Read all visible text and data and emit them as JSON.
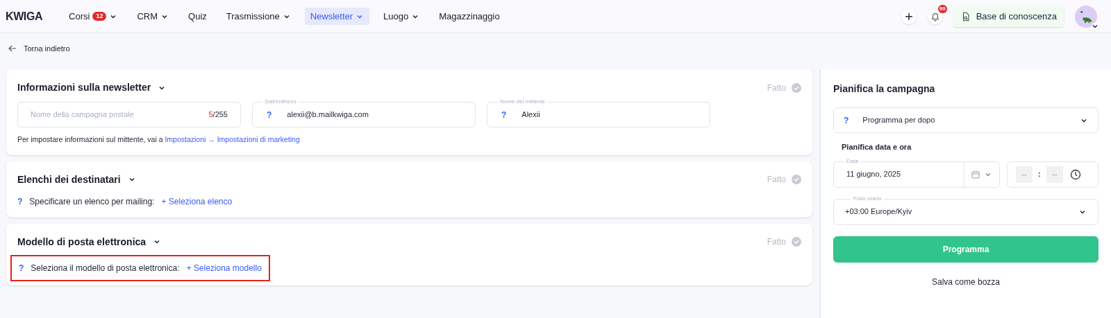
{
  "header": {
    "logo": "KWIGA",
    "nav": [
      {
        "label": "Corsi",
        "badge": "12",
        "dropdown": true,
        "selected": false
      },
      {
        "label": "CRM",
        "dropdown": true,
        "selected": false
      },
      {
        "label": "Quiz",
        "dropdown": false,
        "selected": false
      },
      {
        "label": "Trasmissione",
        "dropdown": true,
        "selected": false
      },
      {
        "label": "Newsletter",
        "dropdown": true,
        "selected": true
      },
      {
        "label": "Luogo",
        "dropdown": true,
        "selected": false
      },
      {
        "label": "Magazzinaggio",
        "dropdown": false,
        "selected": false
      }
    ],
    "notification_count": "99",
    "knowledge_base": "Base di conoscenza"
  },
  "back_link": "Torna indietro",
  "sections": [
    {
      "kind": "info",
      "title": "Informazioni sulla newsletter",
      "status": "Fatto",
      "highlighted": false,
      "campaign_field": {
        "placeholder": "Nome della campagna postale",
        "count": "5",
        "max": "/255"
      },
      "fields": [
        {
          "label": "Dall'indirizzo",
          "hint": "?",
          "value": "alexii@b.mailkwiga.com"
        },
        {
          "label": "Nome del mittente",
          "hint": "?",
          "value": "Alexii"
        }
      ],
      "note": "Per impostare informazioni sul mittente, vai a",
      "note_link": "Impostazioni → Impostazioni di marketing"
    },
    {
      "kind": "prompt",
      "title": "Elenchi dei destinatari",
      "status": "Fatto",
      "highlighted": false,
      "hint": "?",
      "text": "Specificare un elenco per mailing:",
      "link": "+ Seleziona elenco"
    },
    {
      "kind": "prompt",
      "title": "Modello di posta elettronica",
      "status": "Fatto",
      "highlighted": true,
      "hint": "?",
      "text": "Seleziona il modello di posta elettronica:",
      "link": "+ Seleziona modello"
    }
  ],
  "schedule": {
    "title": "Pianifica la campagna",
    "mode": {
      "hint": "?",
      "value": "Programma per dopo"
    },
    "subtitle": "Pianifica data e ora",
    "date": {
      "label": "Data",
      "value": "11 giugno, 2025"
    },
    "time": {
      "hours": "--",
      "separator": ":",
      "minutes": "--"
    },
    "timezone": {
      "label": "Fuso orario",
      "value": "+03:00 Europe/Kyiv"
    },
    "submit": "Programma",
    "draft": "Salva come bozza"
  }
}
